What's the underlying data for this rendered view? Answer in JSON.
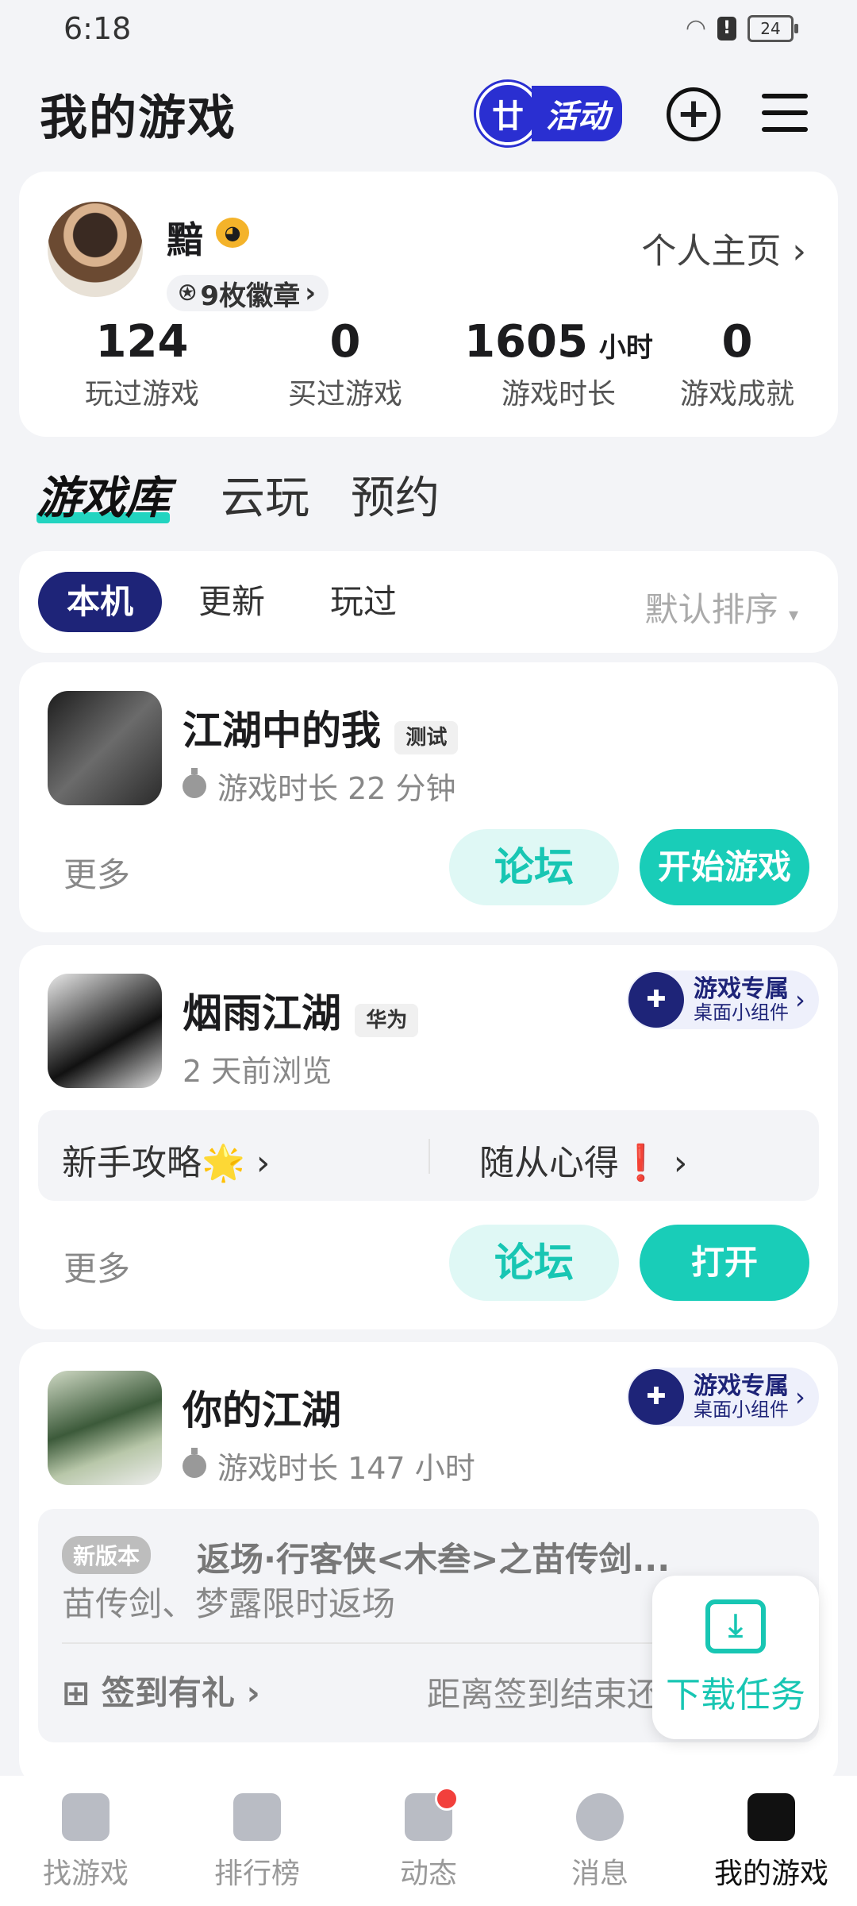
{
  "status_bar": {
    "time": "6:18",
    "battery": "24"
  },
  "header": {
    "title": "我的游戏",
    "activity_label": "活动",
    "activity_badge": "廿"
  },
  "profile": {
    "username": "黯",
    "badges": "9枚徽章",
    "home_link": "个人主页",
    "stats": [
      {
        "value": "124",
        "unit": "",
        "label": "玩过游戏"
      },
      {
        "value": "0",
        "unit": "",
        "label": "买过游戏"
      },
      {
        "value": "1605",
        "unit": "小时",
        "label": "游戏时长"
      },
      {
        "value": "0",
        "unit": "",
        "label": "游戏成就"
      }
    ]
  },
  "library_tabs": [
    "游戏库",
    "云玩",
    "预约"
  ],
  "filter": {
    "chips": [
      "本机",
      "更新",
      "玩过"
    ],
    "sort": "默认排序"
  },
  "games": [
    {
      "name": "江湖中的我",
      "tag": "测试",
      "sub": "游戏时长 22 分钟",
      "more": "更多",
      "forum": "论坛",
      "action": "开始游戏"
    },
    {
      "name": "烟雨江湖",
      "tag": "华为",
      "sub": "2 天前浏览",
      "widget_title": "游戏专属",
      "widget_sub": "桌面小组件",
      "guides": [
        "新手攻略🌟",
        "随从心得❗"
      ],
      "more": "更多",
      "forum": "论坛",
      "action": "打开"
    },
    {
      "name": "你的江湖",
      "sub": "游戏时长 147 小时",
      "widget_title": "游戏专属",
      "widget_sub": "桌面小组件",
      "news_tag": "新版本",
      "news_title": "返场·行客侠<木叁>之苗传剑...",
      "news_body": "苗传剑、梦露限时返场",
      "checkin": "签到有礼",
      "checkin_note": "距离签到结束还"
    }
  ],
  "download": {
    "label": "下载任务"
  },
  "bottom_nav": [
    "找游戏",
    "排行榜",
    "动态",
    "消息",
    "我的游戏"
  ]
}
